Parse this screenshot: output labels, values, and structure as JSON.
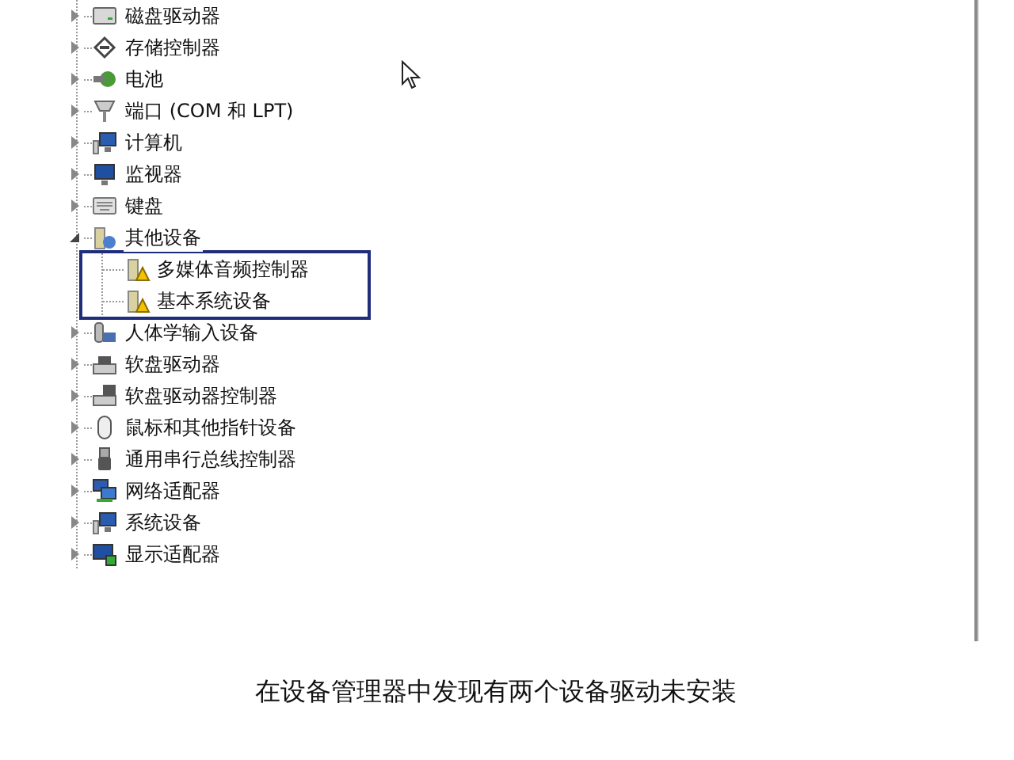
{
  "tree": {
    "items": [
      {
        "label": "磁盘驱动器",
        "kind": "disk",
        "expanded": false
      },
      {
        "label": "存储控制器",
        "kind": "storage",
        "expanded": false
      },
      {
        "label": "电池",
        "kind": "battery",
        "expanded": false
      },
      {
        "label": "端口 (COM 和 LPT)",
        "kind": "port",
        "expanded": false
      },
      {
        "label": "计算机",
        "kind": "computer",
        "expanded": false
      },
      {
        "label": "监视器",
        "kind": "monitor",
        "expanded": false
      },
      {
        "label": "键盘",
        "kind": "keyboard",
        "expanded": false
      },
      {
        "label": "其他设备",
        "kind": "unknown",
        "expanded": true,
        "children_highlighted": true,
        "children": [
          {
            "label": "多媒体音频控制器",
            "kind": "warning"
          },
          {
            "label": "基本系统设备",
            "kind": "warning"
          }
        ]
      },
      {
        "label": "人体学输入设备",
        "kind": "hid",
        "expanded": false
      },
      {
        "label": "软盘驱动器",
        "kind": "floppy",
        "expanded": false
      },
      {
        "label": "软盘驱动器控制器",
        "kind": "floppy-controller",
        "expanded": false
      },
      {
        "label": "鼠标和其他指针设备",
        "kind": "mouse",
        "expanded": false
      },
      {
        "label": "通用串行总线控制器",
        "kind": "usb",
        "expanded": false
      },
      {
        "label": "网络适配器",
        "kind": "network",
        "expanded": false
      },
      {
        "label": "系统设备",
        "kind": "computer",
        "expanded": false
      },
      {
        "label": "显示适配器",
        "kind": "display",
        "expanded": false
      }
    ]
  },
  "caption": "在设备管理器中发现有两个设备驱动未安装"
}
